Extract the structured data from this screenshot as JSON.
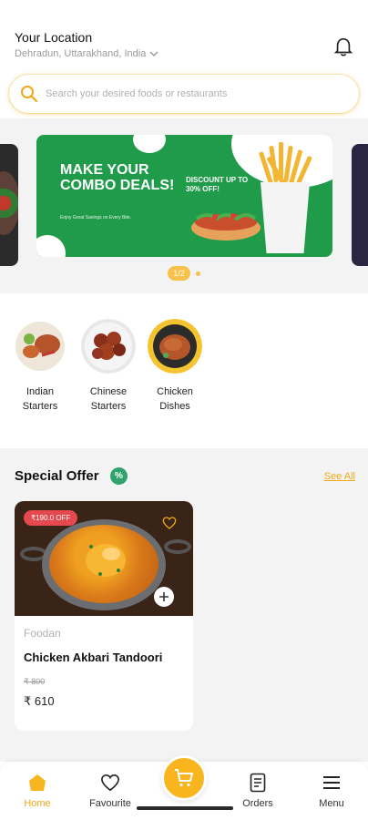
{
  "header": {
    "location_title": "Your Location",
    "location_value": "Dehradun, Uttarakhand, India",
    "search_placeholder": "Search your desired foods or restaurants"
  },
  "banner": {
    "headline": "MAKE YOUR COMBO DEALS!",
    "subtext": "Enjoy Great Savings on Every Bite.",
    "discount": "DISCOUNT UP TO 30% OFF!",
    "pager": "1/2"
  },
  "categories": [
    {
      "label": "Indian Starters"
    },
    {
      "label": "Chinese Starters"
    },
    {
      "label": "Chicken Dishes"
    }
  ],
  "special_offer": {
    "title": "Special Offer",
    "badge_icon": "%",
    "see_all": "See All",
    "items": [
      {
        "discount_badge": "₹190.0 OFF",
        "restaurant": "Foodan",
        "name": "Chicken Akbari Tandoori",
        "old_price": "₹ 800",
        "price": "₹ 610"
      }
    ]
  },
  "nav": {
    "home": "Home",
    "favourite": "Favourite",
    "orders": "Orders",
    "menu": "Menu"
  },
  "colors": {
    "accent": "#f9b51e",
    "banner_green": "#1f9b4a",
    "offer_badge": "#e5484d",
    "percent_badge": "#2fa36b"
  }
}
